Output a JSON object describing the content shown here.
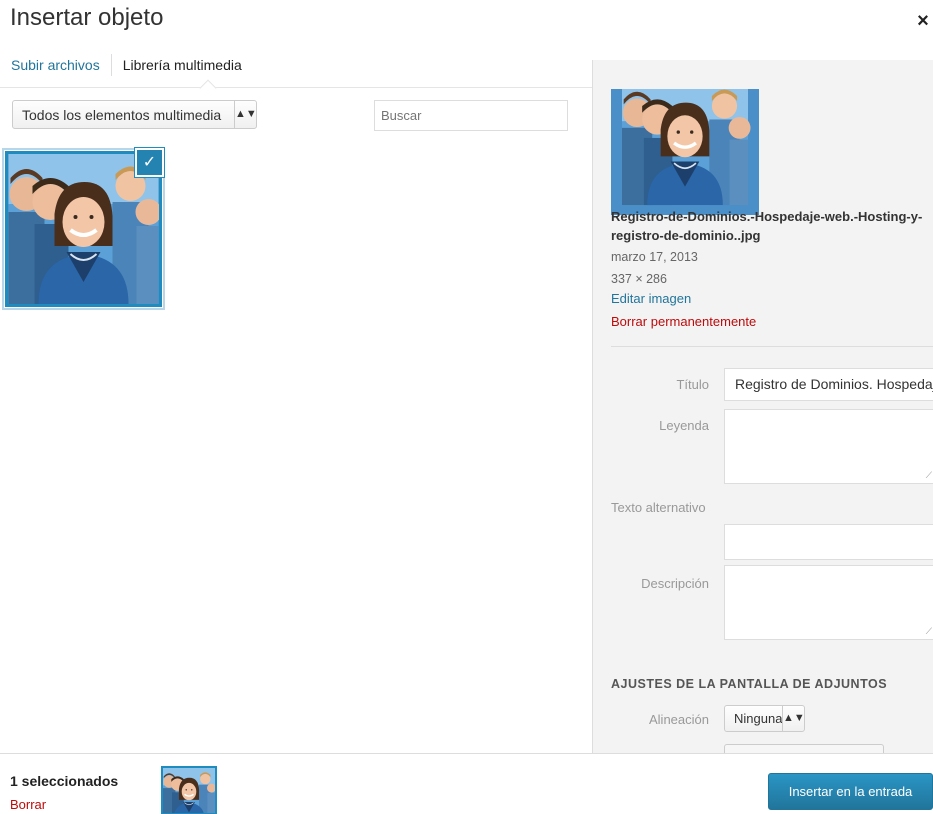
{
  "modal": {
    "title": "Insertar objeto",
    "close_symbol": "×"
  },
  "tabs": [
    {
      "label": "Subir archivos",
      "active": true
    },
    {
      "label": "Librería multimedia",
      "active": false
    }
  ],
  "toolbar": {
    "filter_selected": "Todos los elementos multimedia",
    "search_placeholder": "Buscar"
  },
  "attachment": {
    "filename": "Registro-de-Dominios.-Hospedaje-web.-Hosting-y-registro-de-dominio..jpg",
    "date": "marzo 17, 2013",
    "dimensions": "337 × 286",
    "edit_link": "Editar imagen",
    "delete_link": "Borrar permanentemente"
  },
  "fields": {
    "title_label": "Título",
    "title_value": "Registro de Dominios. Hospedaje web. Hosting y registro de dominio.",
    "caption_label": "Leyenda",
    "caption_value": "",
    "alt_label": "Texto alternativo",
    "alt_value": "",
    "description_label": "Descripción",
    "description_value": ""
  },
  "display_settings": {
    "heading": "AJUSTES DE LA PANTALLA DE ADJUNTOS",
    "alignment_label": "Alineación",
    "alignment_value": "Ninguna"
  },
  "footer": {
    "selection_count": "1 seleccionados",
    "clear_link": "Borrar",
    "insert_button": "Insertar en la entrada"
  },
  "colors": {
    "accent": "#21759b",
    "selection_border": "#1e8cbe",
    "danger": "#bc0b0b"
  }
}
